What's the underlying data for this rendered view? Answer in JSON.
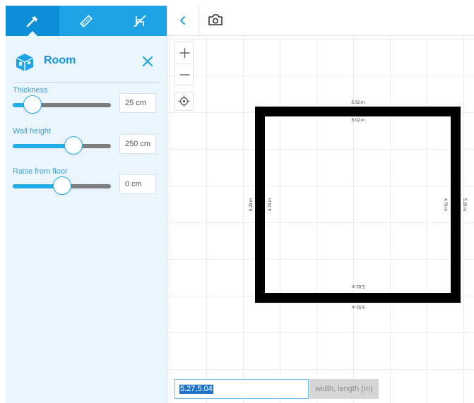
{
  "tabs": [
    {
      "name": "hammer-icon",
      "active": true
    },
    {
      "name": "ruler-icon",
      "active": false
    },
    {
      "name": "chair-icon",
      "active": false
    }
  ],
  "panel": {
    "title": "Room",
    "fields": [
      {
        "label": "Thickness",
        "value": "25 cm",
        "level": 0.2
      },
      {
        "label": "Wall height",
        "value": "250 cm",
        "level": 0.62
      },
      {
        "label": "Raise from floor",
        "value": "0 cm",
        "level": 0.5
      }
    ]
  },
  "dimensions": {
    "top_outer": "5.52 m",
    "top_inner": "5.02 m",
    "bottom_inner": "5.02 m",
    "bottom_outer": "5.52 m",
    "left_outer": "5.29 m",
    "left_inner": "4.79 m",
    "right_inner": "4.79 m",
    "right_outer": "5.29 m"
  },
  "input": {
    "value": "5.27,5.04",
    "hint": "width, length (m)"
  },
  "colors": {
    "accent": "#1ea4e6",
    "wall": "#000000"
  }
}
